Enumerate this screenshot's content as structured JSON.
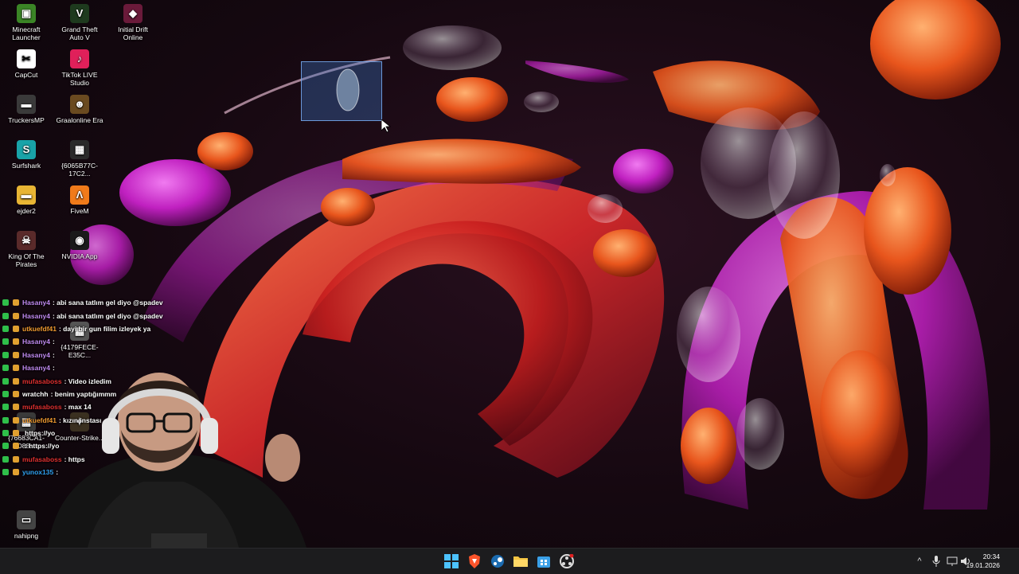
{
  "desktop": {
    "icons": [
      {
        "label": "Minecraft Launcher",
        "icon": "minecraft-icon",
        "color": "#3b8526",
        "glyph": "▣"
      },
      {
        "label": "Grand Theft Auto V",
        "icon": "gta-v-icon",
        "color": "#1e3a1e",
        "glyph": "V"
      },
      {
        "label": "Initial Drift Online",
        "icon": "initial-drift-icon",
        "color": "#6a1a3a",
        "glyph": "◆"
      },
      {
        "label": "CapCut",
        "icon": "capcut-icon",
        "color": "#ffffff",
        "glyph": "✂"
      },
      {
        "label": "TikTok LIVE Studio",
        "icon": "tiktok-live-icon",
        "color": "#e0205a",
        "glyph": "♪"
      },
      {
        "label": "TruckersMP",
        "icon": "truckersmp-icon",
        "color": "#3a3a3a",
        "glyph": "▬"
      },
      {
        "label": "Graalonline Era",
        "icon": "graalonline-icon",
        "color": "#6a4a20",
        "glyph": "☻"
      },
      {
        "label": "Surfshark",
        "icon": "surfshark-icon",
        "color": "#19a3a8",
        "glyph": "S"
      },
      {
        "label": "{6065B77C-17C2...",
        "icon": "file-icon",
        "color": "#2a2a2a",
        "glyph": "▦"
      },
      {
        "label": "ejder2",
        "icon": "folder-icon",
        "color": "#e8b534",
        "glyph": "▬"
      },
      {
        "label": "FiveM",
        "icon": "fivem-icon",
        "color": "#f07a1a",
        "glyph": "Λ"
      },
      {
        "label": "King Of The Pirates",
        "icon": "king-of-pirates-icon",
        "color": "#5a2a2a",
        "glyph": "☠"
      },
      {
        "label": "NVIDIA App",
        "icon": "nvidia-icon",
        "color": "#1a1a1a",
        "glyph": "◉"
      },
      {
        "label": "{4179FECE-E35C...",
        "icon": "file-icon",
        "color": "#555555",
        "glyph": "▦"
      },
      {
        "label": "{76683CA1-D88...",
        "icon": "file-icon",
        "color": "#3a3a3a",
        "glyph": "▦"
      },
      {
        "label": "Counter-Strike...",
        "icon": "counter-strike-icon",
        "color": "#3a3020",
        "glyph": "✦"
      },
      {
        "label": "nahipng",
        "icon": "image-file-icon",
        "color": "#444444",
        "glyph": "▭"
      }
    ]
  },
  "chat": {
    "lines": [
      {
        "user": "Hasany4",
        "message": ": abi sana tatlım gel diyo @spadev",
        "user_color": "#c08af0"
      },
      {
        "user": "Hasany4",
        "message": ": abi sana tatlım gel diyo @spadev",
        "user_color": "#c08af0"
      },
      {
        "user": "utkuefdf41",
        "message": ": dayi bir gun filim izleyek ya",
        "user_color": "#f09a30"
      },
      {
        "user": "Hasany4",
        "message": ":",
        "user_color": "#c08af0"
      },
      {
        "user": "Hasany4",
        "message": ":",
        "user_color": "#c08af0"
      },
      {
        "user": "Hasany4",
        "message": ":",
        "user_color": "#c08af0"
      },
      {
        "user": "mufasaboss",
        "message": ": Video izledim",
        "user_color": "#e03030"
      },
      {
        "user": "wratchh",
        "message": ": benim yaptığımmm",
        "user_color": "#ffffff"
      },
      {
        "user": "mufasaboss",
        "message": ": max 14",
        "user_color": "#e03030"
      },
      {
        "user": "utkuefdf41",
        "message": ": kızın instası",
        "user_color": "#f09a30"
      },
      {
        "user": "",
        "message": "https://yo",
        "user_color": "#ffffff"
      },
      {
        "user": "",
        "message": ": https://yo",
        "user_color": "#ffffff"
      },
      {
        "user": "mufasaboss",
        "message": ": https",
        "user_color": "#e03030"
      },
      {
        "user": "yunox135",
        "message": ":",
        "user_color": "#30a0f0"
      }
    ]
  },
  "taskbar": {
    "apps": [
      {
        "name": "start-button",
        "icon": "windows-icon"
      },
      {
        "name": "brave-browser",
        "icon": "brave-icon"
      },
      {
        "name": "steam",
        "icon": "steam-icon"
      },
      {
        "name": "file-explorer",
        "icon": "folder-icon"
      },
      {
        "name": "microsoft-store",
        "icon": "store-icon"
      },
      {
        "name": "obs-studio",
        "icon": "obs-icon"
      }
    ],
    "tray": {
      "chevron": "^",
      "icons": [
        "microphone-icon",
        "network-icon",
        "volume-icon"
      ]
    },
    "clock": {
      "time": "20:34",
      "date": "19.01.2026"
    }
  },
  "colors": {
    "taskbar_bg": "#1c1c1e",
    "selection": "#3c78c8",
    "wallpaper_orange": "#e8551c",
    "wallpaper_magenta": "#c020c0"
  }
}
